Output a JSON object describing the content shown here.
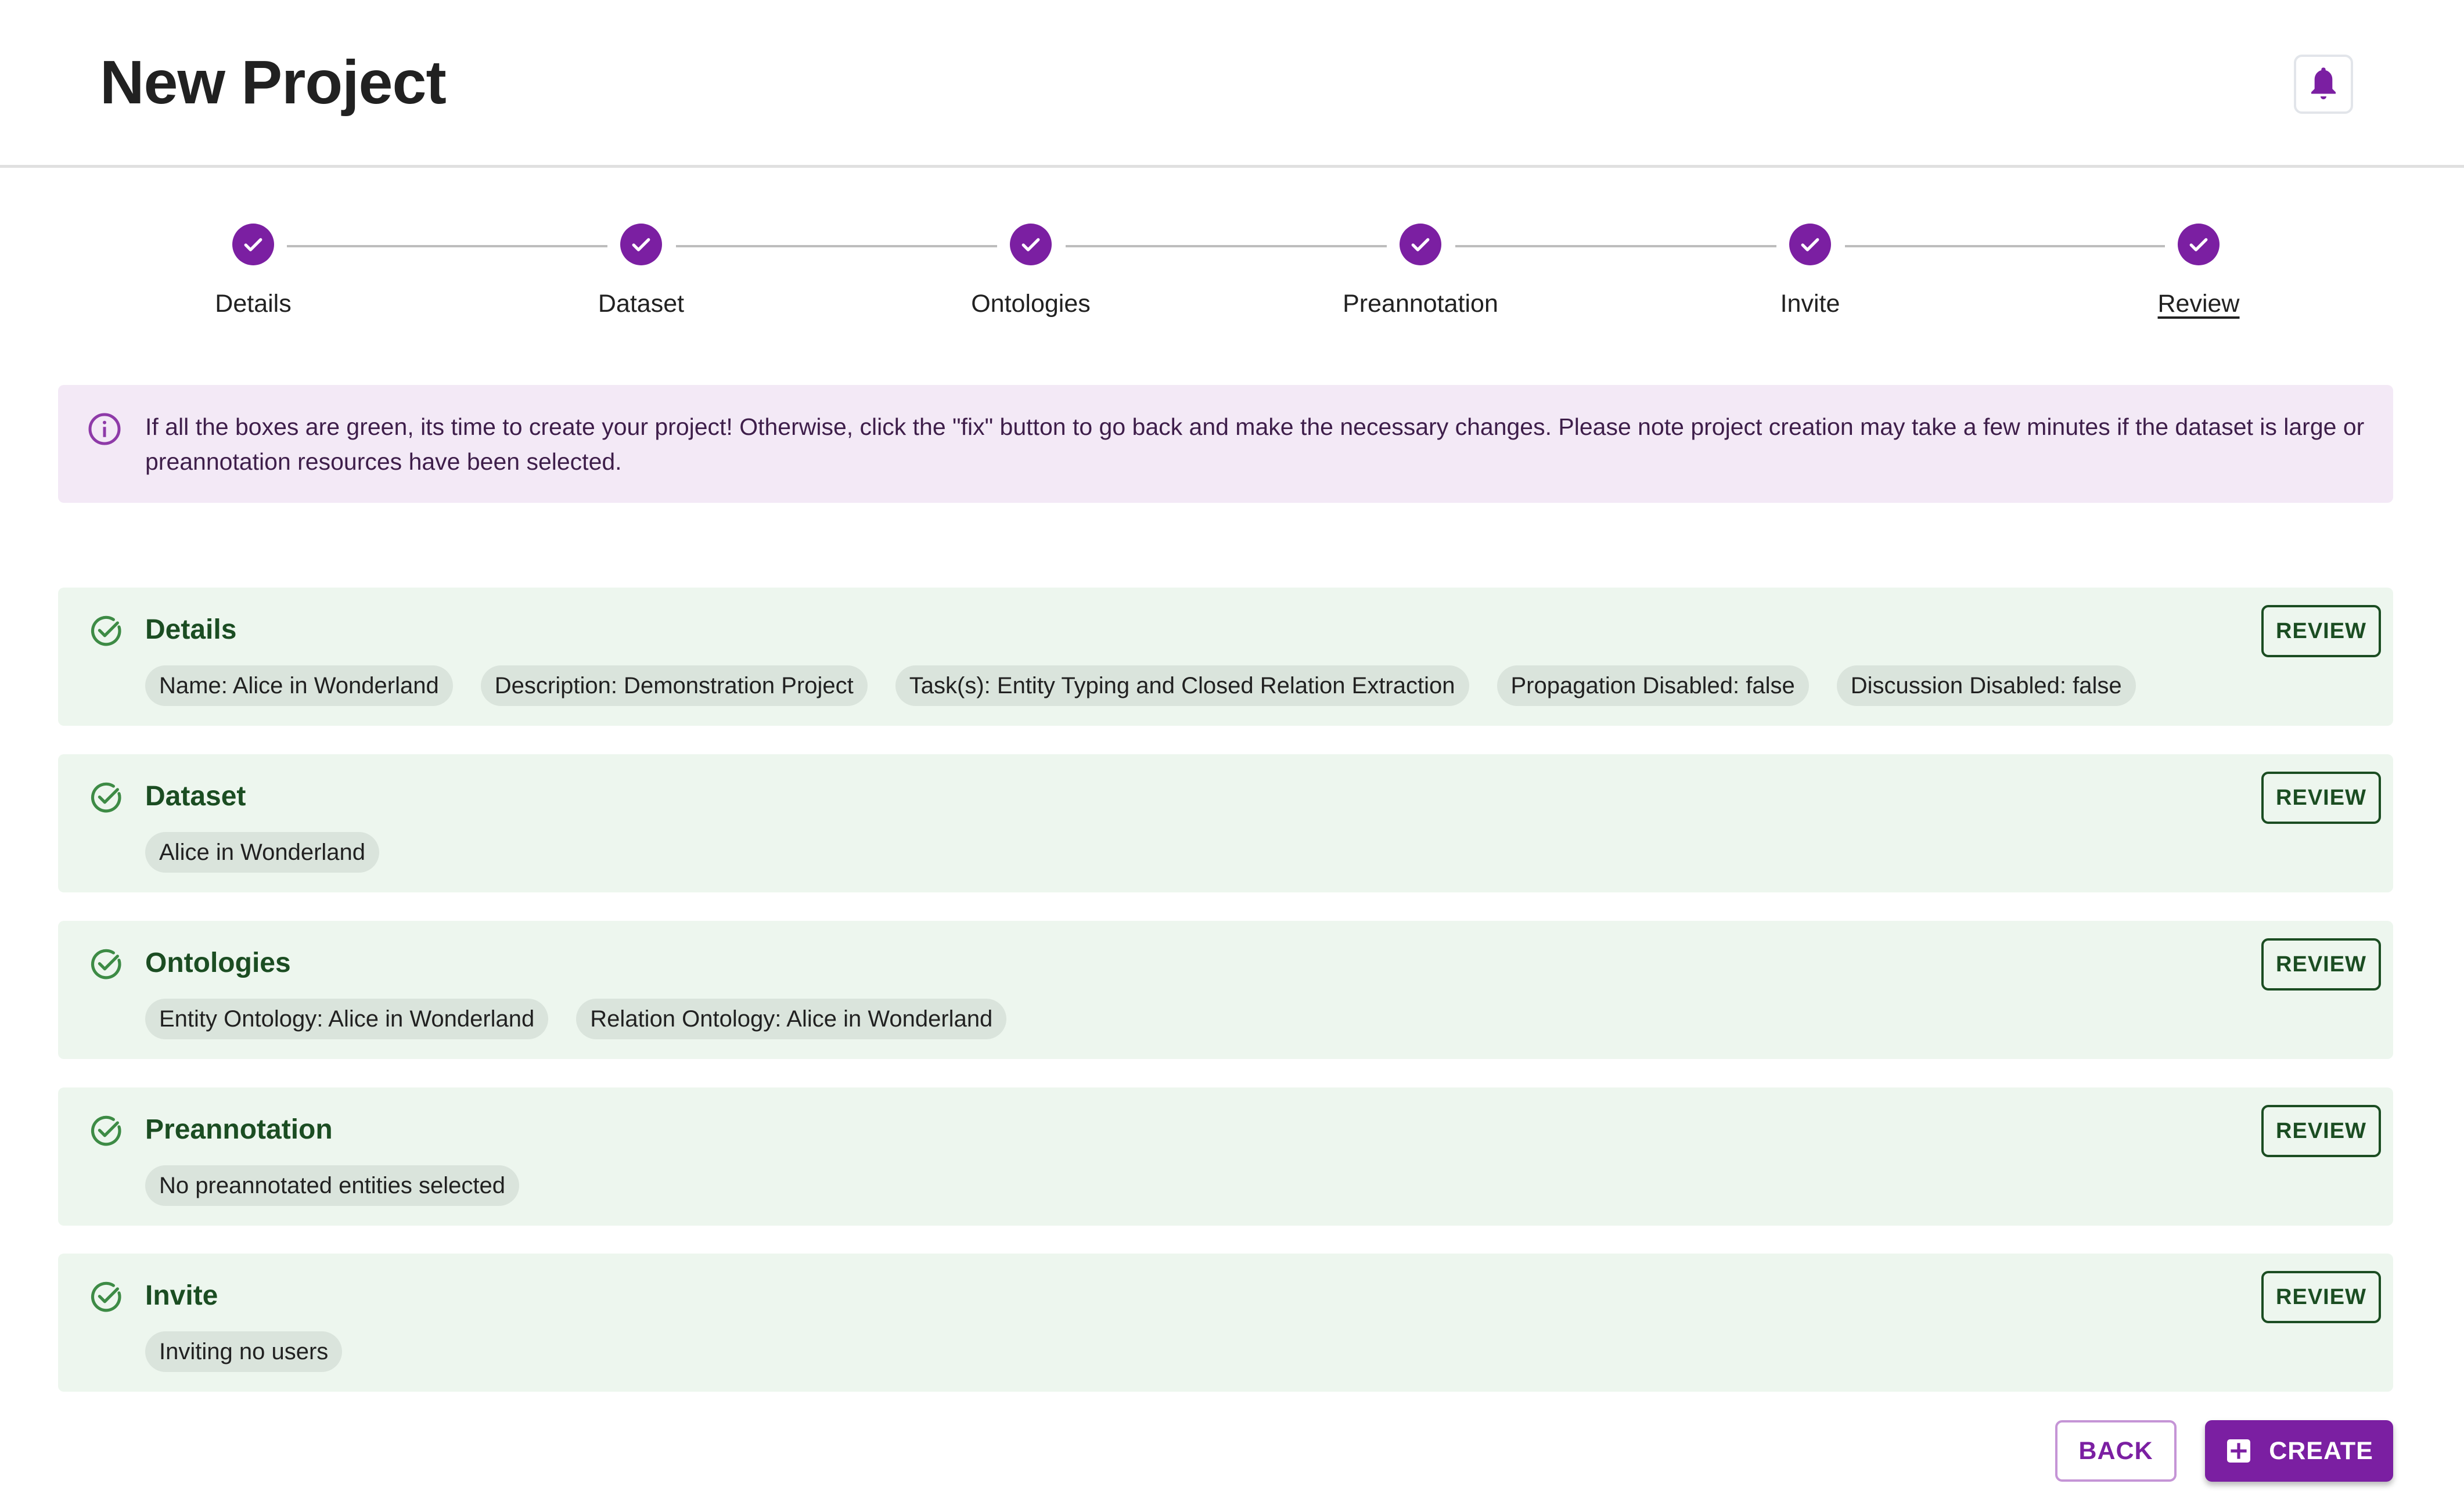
{
  "header": {
    "title": "New Project",
    "notifications_icon": "bell-icon"
  },
  "stepper": {
    "steps": [
      {
        "label": "Details",
        "status": "complete"
      },
      {
        "label": "Dataset",
        "status": "complete"
      },
      {
        "label": "Ontologies",
        "status": "complete"
      },
      {
        "label": "Preannotation",
        "status": "complete"
      },
      {
        "label": "Invite",
        "status": "complete"
      },
      {
        "label": "Review",
        "status": "complete",
        "active": true
      }
    ]
  },
  "info_banner": {
    "icon": "info-icon",
    "text": "If all the boxes are green, its time to create your project! Otherwise, click the \"fix\" button to go back and make the necessary changes. Please note project creation may take a few minutes if the dataset is large or preannotation resources have been selected."
  },
  "review_sections": [
    {
      "title": "Details",
      "status": "valid",
      "button_label": "REVIEW",
      "chips": [
        "Name: Alice in Wonderland",
        "Description: Demonstration Project",
        "Task(s): Entity Typing and Closed Relation Extraction",
        "Propagation Disabled: false",
        "Discussion Disabled: false"
      ]
    },
    {
      "title": "Dataset",
      "status": "valid",
      "button_label": "REVIEW",
      "chips": [
        "Alice in Wonderland"
      ]
    },
    {
      "title": "Ontologies",
      "status": "valid",
      "button_label": "REVIEW",
      "chips": [
        "Entity Ontology: Alice in Wonderland",
        "Relation Ontology: Alice in Wonderland"
      ]
    },
    {
      "title": "Preannotation",
      "status": "valid",
      "button_label": "REVIEW",
      "chips": [
        "No preannotated entities selected"
      ]
    },
    {
      "title": "Invite",
      "status": "valid",
      "button_label": "REVIEW",
      "chips": [
        "Inviting no users"
      ]
    }
  ],
  "footer": {
    "back_label": "BACK",
    "create_label": "CREATE",
    "create_icon": "add-box-icon"
  },
  "colors": {
    "primary": "#7b1fa2",
    "success_dark": "#1b4d22",
    "success_icon": "#3d8b45",
    "card_bg": "#edf6ee",
    "chip_bg": "#dae4dc",
    "info_bg": "#f3e9f6"
  }
}
